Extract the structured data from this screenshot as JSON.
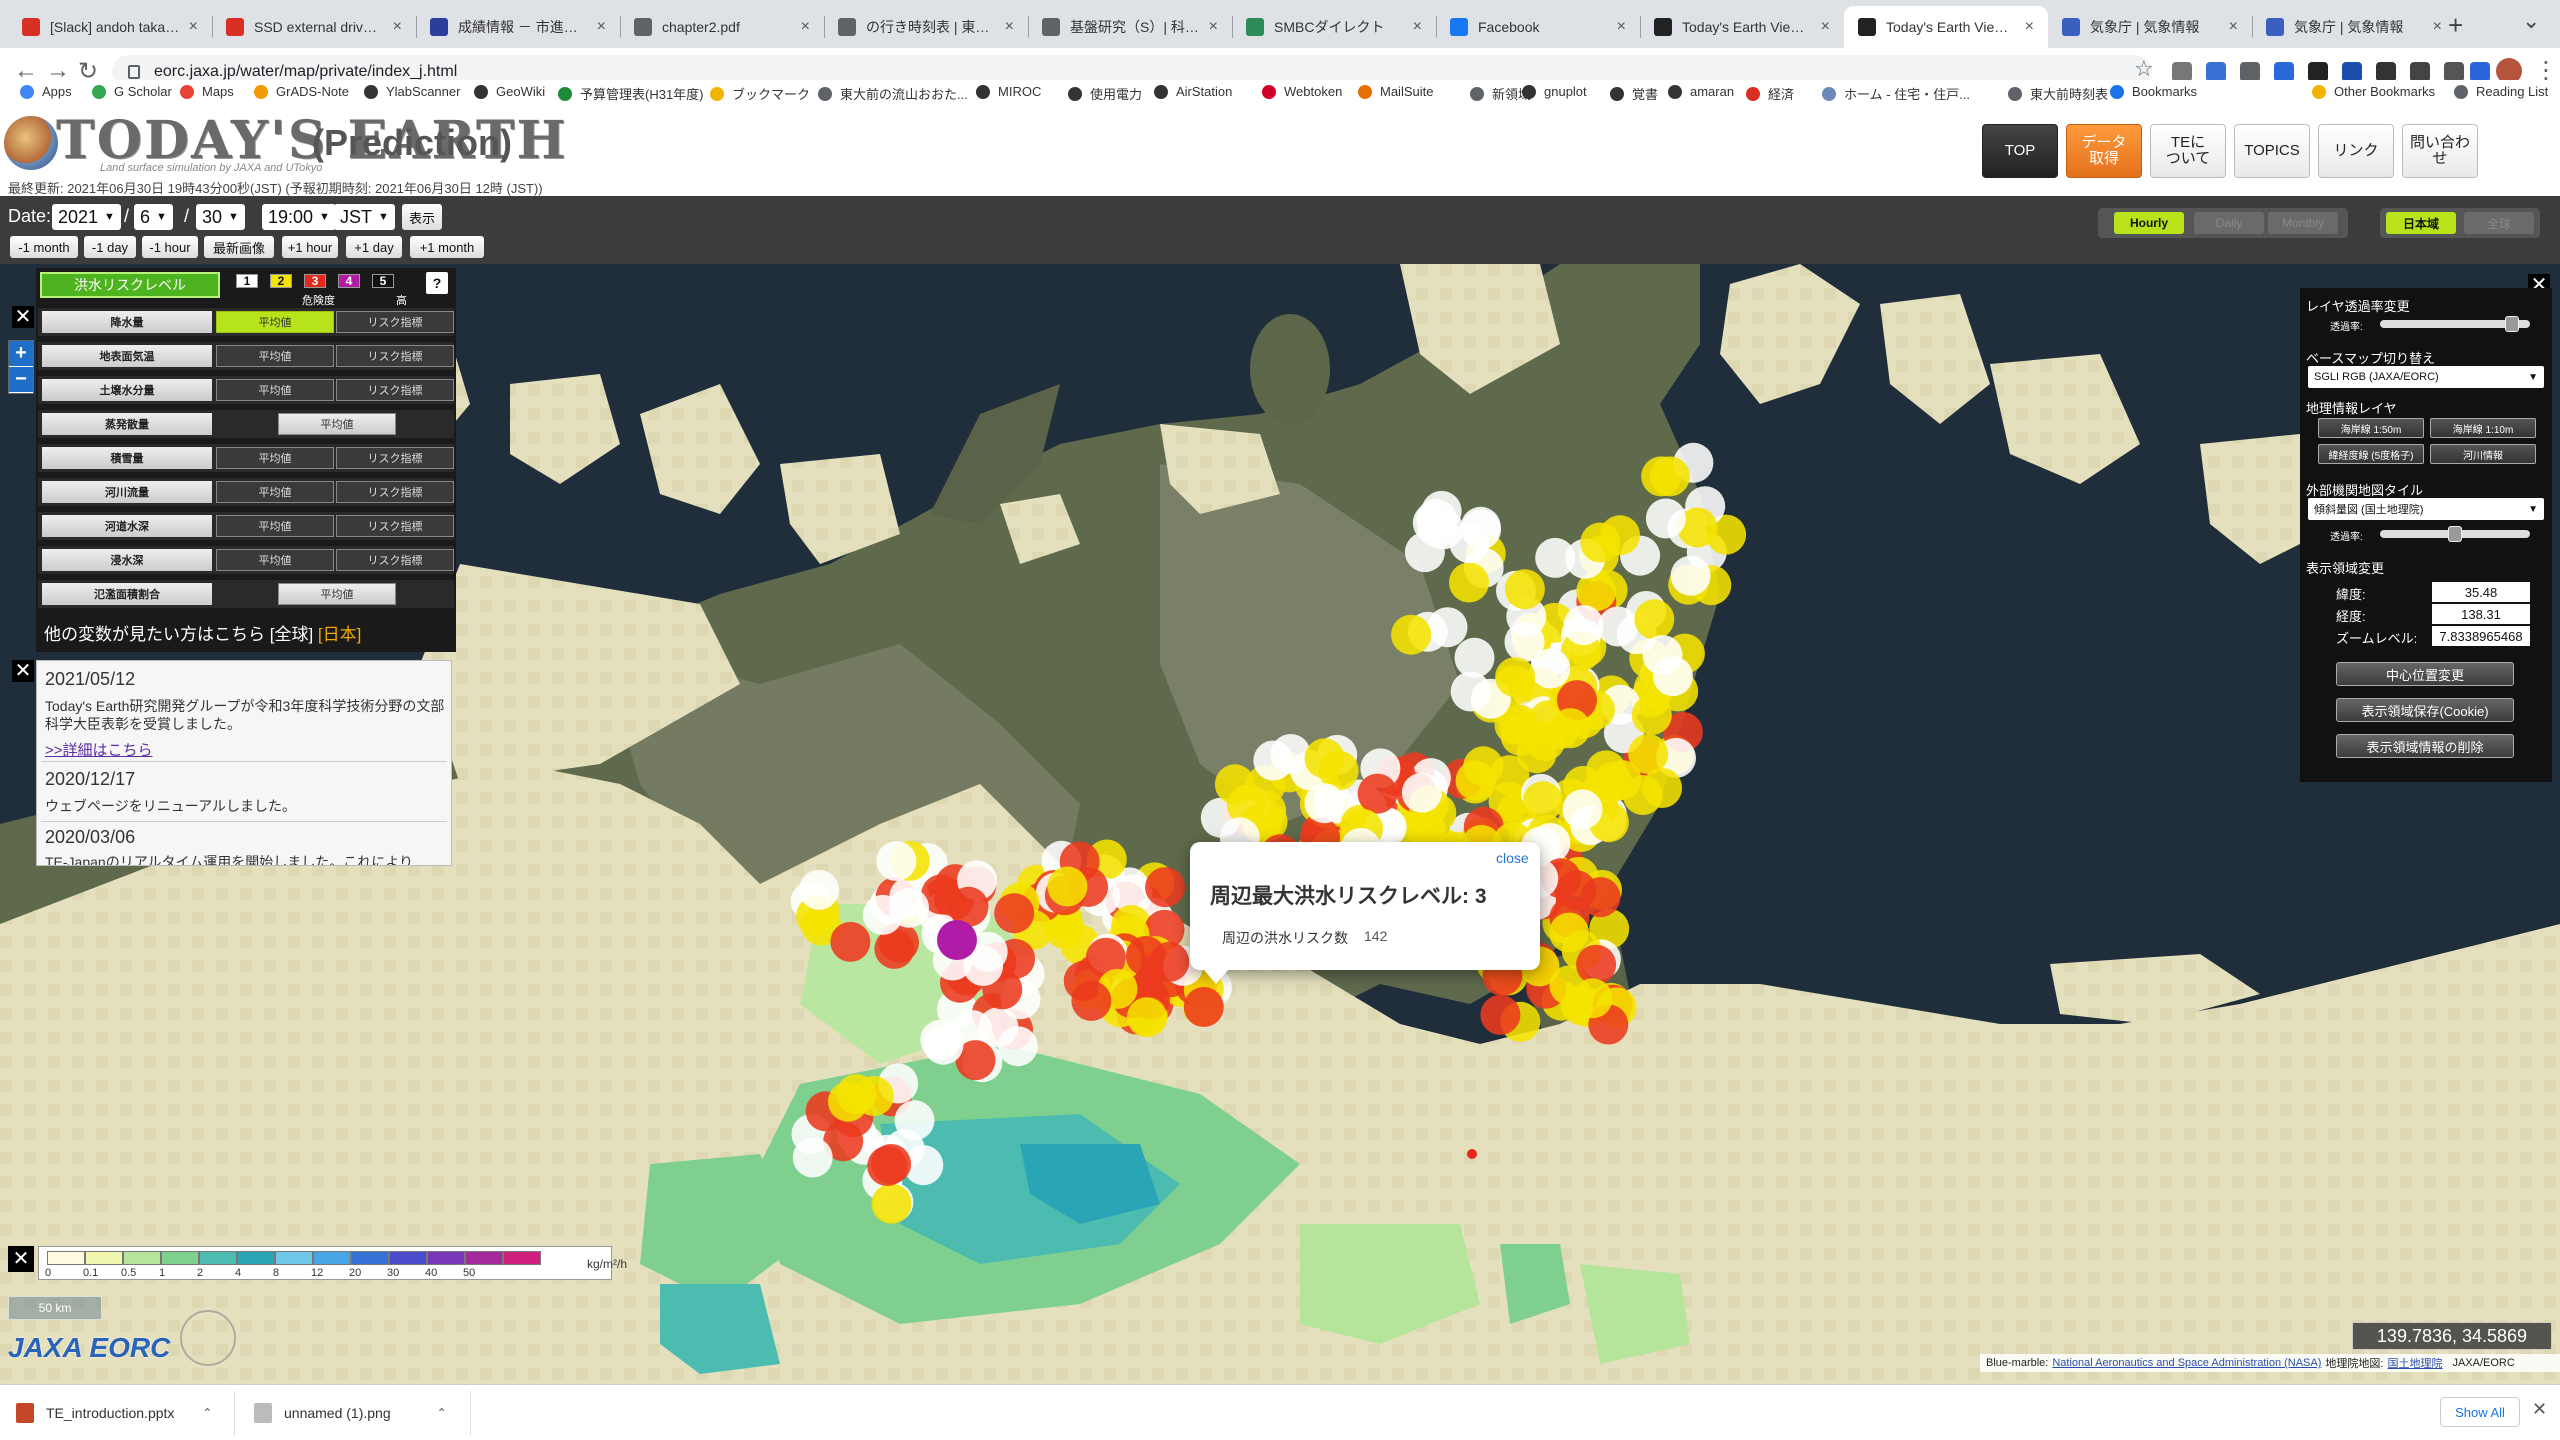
{
  "browser": {
    "tabs": [
      {
        "title": "[Slack] andoh takafusa",
        "icon_color": "#d93025"
      },
      {
        "title": "SSD external drive - kei",
        "icon_color": "#d93025"
      },
      {
        "title": "成績情報 － 市進マイペー",
        "icon_color": "#2a3e9c"
      },
      {
        "title": "chapter2.pdf",
        "icon_color": "#5f6368"
      },
      {
        "title": "の行き時刻表 | 東武バス",
        "icon_color": "#5f6368"
      },
      {
        "title": "基盤研究（S）| 科学研究",
        "icon_color": "#5f6368"
      },
      {
        "title": "SMBCダイレクト",
        "icon_color": "#2e8b57"
      },
      {
        "title": "Facebook",
        "icon_color": "#1877f2"
      },
      {
        "title": "Today's Earth Viewer",
        "icon_color": "#222"
      },
      {
        "title": "Today's Earth Viewer",
        "icon_color": "#222"
      },
      {
        "title": "気象庁 | 気象情報",
        "icon_color": "#3b5fc0"
      },
      {
        "title": "気象庁 | 気象情報",
        "icon_color": "#3b5fc0"
      }
    ],
    "active_tab_index": 9,
    "url": "eorc.jaxa.jp/water/map/private/index_j.html",
    "bookmarks": [
      "Apps",
      "G Scholar",
      "Maps",
      "GrADS-Note",
      "YlabScanner",
      "GeoWiki",
      "予算管理表(H31年度)",
      "ブックマーク",
      "東大前の流山おおた...",
      "MIROC",
      "使用電力",
      "AirStation",
      "Webtoken",
      "MailSuite",
      "新領域",
      "gnuplot",
      "覚書",
      "amaran",
      "経済",
      "ホーム - 住宅・住戸...",
      "東大前時刻表",
      "Bookmarks",
      "Other Bookmarks",
      "Reading List"
    ]
  },
  "site": {
    "logo_text": "TODAY'S EARTH",
    "logo_sub": "Land surface simulation by JAXA and UTokyo",
    "mode": "(Prediction)",
    "last_update": "最終更新: 2021年06月30日 19時43分00秒(JST) (予報初期時刻: 2021年06月30日 12時 (JST))",
    "nav": [
      {
        "label": "TOP",
        "style": "dark"
      },
      {
        "label": "データ\n取得",
        "style": "orange"
      },
      {
        "label": "TEに\nついて",
        "style": "light"
      },
      {
        "label": "TOPICS",
        "style": "light"
      },
      {
        "label": "リンク",
        "style": "light"
      },
      {
        "label": "問い合わせ",
        "style": "light"
      }
    ]
  },
  "controls": {
    "date_label": "Date:",
    "year": "2021",
    "month": "6",
    "day": "30",
    "time": "19:00",
    "timezone": "JST",
    "show_label": "表示",
    "step_buttons": [
      "-1 month",
      "-1 day",
      "-1 hour",
      "最新画像",
      "+1 hour",
      "+1 day",
      "+1 month"
    ],
    "period": {
      "hourly": "Hourly",
      "daily": "Daily",
      "monthly": "Monthly"
    },
    "region": {
      "japan": "日本域",
      "global": "全球"
    }
  },
  "layer_panel": {
    "flood_label": "洪水リスクレベル",
    "risk_levels": [
      "1",
      "2",
      "3",
      "4",
      "5"
    ],
    "risk_colors": [
      "#ffffff",
      "#f5e300",
      "#e8271c",
      "#b01ca6",
      "#111111"
    ],
    "risk_caption": "危険度",
    "risk_high": "高",
    "help": "?",
    "variables": [
      {
        "name": "降水量",
        "avg": "平均値",
        "risk": "リスク指標",
        "avg_active": true
      },
      {
        "name": "地表面気温",
        "avg": "平均値",
        "risk": "リスク指標"
      },
      {
        "name": "土壌水分量",
        "avg": "平均値",
        "risk": "リスク指標"
      },
      {
        "name": "蒸発散量",
        "avg": "平均値",
        "single": true
      },
      {
        "name": "積雪量",
        "avg": "平均値",
        "risk": "リスク指標"
      },
      {
        "name": "河川流量",
        "avg": "平均値",
        "risk": "リスク指標"
      },
      {
        "name": "河道水深",
        "avg": "平均値",
        "risk": "リスク指標"
      },
      {
        "name": "浸水深",
        "avg": "平均値",
        "risk": "リスク指標"
      },
      {
        "name": "氾濫面積割合",
        "avg": "平均値",
        "single": true
      }
    ],
    "more_text": "他の変数が見たい方はこちら",
    "more_global": "[全球]",
    "more_japan": "[日本]"
  },
  "news": [
    {
      "date": "2021/05/12",
      "text": "Today's Earth研究開発グループが令和3年度科学技術分野の文部科学大臣表彰を受賞しました。",
      "link": ">>詳細はこちら"
    },
    {
      "date": "2020/12/17",
      "text": "ウェブページをリニューアルしました。"
    },
    {
      "date": "2020/03/06",
      "text": "TE-Japanのリアルタイム運用を開始しました。これにより"
    }
  ],
  "popup": {
    "close": "close",
    "title": "周辺最大洪水リスクレベル: 3",
    "count_label": "周辺の洪水リスク数",
    "count": "142"
  },
  "right_panel": {
    "opacity_title": "レイヤ透過率変更",
    "opacity_label": "透過率:",
    "opacity_value": 0.88,
    "basemap_title": "ベースマップ切り替え",
    "basemap_value": "SGLI RGB (JAXA/EORC)",
    "geo_title": "地理情報レイヤ",
    "geo_buttons": [
      "海岸線 1:50m",
      "海岸線 1:10m",
      "緯経度線 (5度格子)",
      "河川情報"
    ],
    "tile_title": "外部機関地図タイル",
    "tile_value": "傾斜量図 (国土地理院)",
    "tile_opacity_label": "透過率:",
    "tile_opacity_value": 0.5,
    "view_title": "表示領域変更",
    "lat_label": "緯度:",
    "lat": "35.48",
    "lon_label": "経度:",
    "lon": "138.31",
    "zoom_label": "ズームレベル:",
    "zoom": "7.8338965468",
    "btn_center": "中心位置変更",
    "btn_save": "表示領域保存(Cookie)",
    "btn_delete": "表示領域情報の削除"
  },
  "legend": {
    "labels": [
      "0",
      "0.1",
      "0.5",
      "1",
      "2",
      "4",
      "8",
      "12",
      "20",
      "30",
      "40",
      "50"
    ],
    "colors": [
      "#fffbe0",
      "#f0f5b0",
      "#b5e59a",
      "#7fd08d",
      "#4cbcb0",
      "#2aa5b6",
      "#6fc8e8",
      "#48a6e6",
      "#3472d6",
      "#4a4bcb",
      "#7a36b8",
      "#a52a9e",
      "#d01f7f"
    ],
    "unit": "kg/m²/h"
  },
  "map": {
    "scale": "50 km",
    "coords": "139.7836, 34.5869",
    "attribution_prefix": "Blue-marble:",
    "attribution_link": "National Aeronautics and Space Administration (NASA)",
    "attribution_mid": "地理院地図:",
    "attribution_link2": "国土地理院",
    "attribution_suffix": "JAXA/EORC",
    "logo": "JAXA EORC"
  },
  "downloads": {
    "items": [
      "TE_introduction.pptx",
      "unnamed (1).png"
    ],
    "show_all": "Show All"
  }
}
